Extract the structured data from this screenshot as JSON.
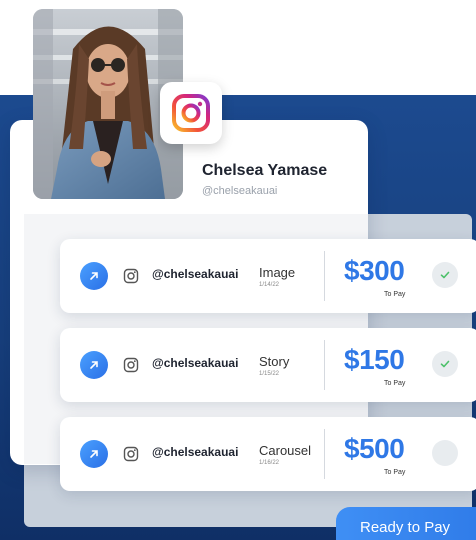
{
  "profile": {
    "name": "Chelsea Yamase",
    "handle": "@chelseakauai"
  },
  "colors": {
    "accent_blue": "#2f78e6",
    "navy_background": "#1c4a8f",
    "check_green": "#4cc16a"
  },
  "icons": {
    "badge": "instagram-icon",
    "row_action": "arrow-up-right-icon",
    "row_platform": "instagram-outline-icon",
    "row_status": "checkmark-icon"
  },
  "rows": [
    {
      "handle": "@chelseakauai",
      "type": "Image",
      "date": "1/14/22",
      "amount": "$300",
      "pay_label": "To Pay",
      "checked": true
    },
    {
      "handle": "@chelseakauai",
      "type": "Story",
      "date": "1/15/22",
      "amount": "$150",
      "pay_label": "To Pay",
      "checked": true
    },
    {
      "handle": "@chelseakauai",
      "type": "Carousel",
      "date": "1/16/22",
      "amount": "$500",
      "pay_label": "To Pay",
      "checked": false
    }
  ],
  "cta": {
    "label": "Ready to Pay"
  }
}
